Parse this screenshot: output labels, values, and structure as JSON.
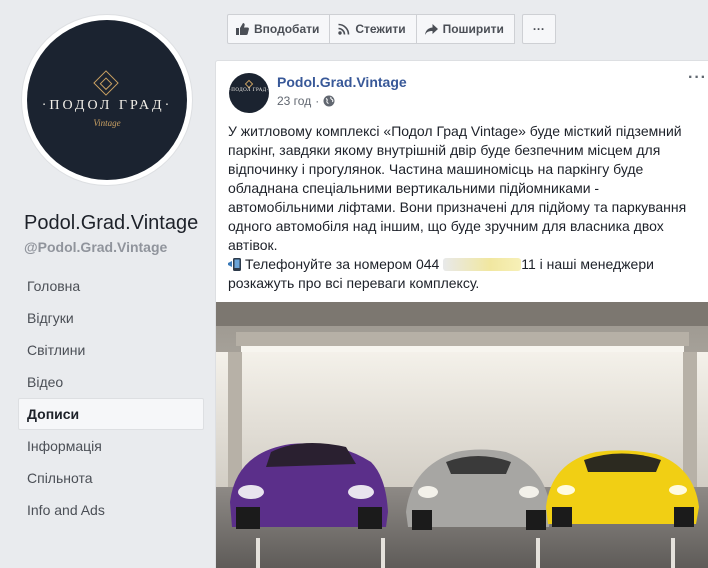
{
  "page": {
    "name": "Podol.Grad.Vintage",
    "handle": "@Podol.Grad.Vintage",
    "logo_text": "·ПОДОЛ ГРАД·",
    "logo_sub": "Vintage"
  },
  "nav": [
    {
      "label": "Головна",
      "active": false
    },
    {
      "label": "Відгуки",
      "active": false
    },
    {
      "label": "Світлини",
      "active": false
    },
    {
      "label": "Відео",
      "active": false
    },
    {
      "label": "Дописи",
      "active": true
    },
    {
      "label": "Інформація",
      "active": false
    },
    {
      "label": "Спільнота",
      "active": false
    },
    {
      "label": "Info and Ads",
      "active": false
    }
  ],
  "actions": {
    "like": "Вподобати",
    "follow": "Стежити",
    "share": "Поширити",
    "more": "···"
  },
  "post": {
    "author": "Podol.Grad.Vintage",
    "time": "23 год",
    "more": "···",
    "paragraph": "У житловому комплексі «Подол Град Vintage» буде місткий підземний паркінг, завдяки якому внутрішній двір буде безпечним місцем для відпочинку і прогулянок. Частина машиномісць на паркінгу буде обладнана спеціальними вертикальними підйомниками - автомобільними ліфтами. Вони призначені для підйому та паркування одного автомобіля над іншим, що буде зручним для власника двох автівок.",
    "phone_prefix": "Телефонуйте за номером 044",
    "phone_suffix": "11 і наші менеджери розкажуть про всі переваги комплексу."
  },
  "colors": {
    "link": "#385898",
    "background": "#e9ebee",
    "card": "#ffffff"
  }
}
